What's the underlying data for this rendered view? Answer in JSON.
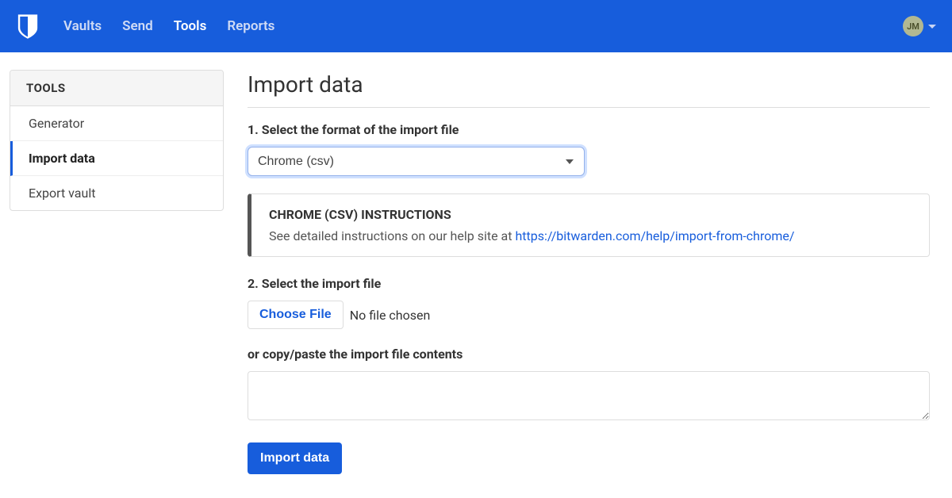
{
  "nav": {
    "items": [
      {
        "label": "Vaults",
        "active": false
      },
      {
        "label": "Send",
        "active": false
      },
      {
        "label": "Tools",
        "active": true
      },
      {
        "label": "Reports",
        "active": false
      }
    ]
  },
  "user": {
    "initials": "JM"
  },
  "sidebar": {
    "header": "TOOLS",
    "items": [
      {
        "label": "Generator",
        "active": false
      },
      {
        "label": "Import data",
        "active": true
      },
      {
        "label": "Export vault",
        "active": false
      }
    ]
  },
  "page": {
    "title": "Import data",
    "step1_label": "1. Select the format of the import file",
    "format_selected": "Chrome (csv)",
    "info": {
      "title": "CHROME (CSV) INSTRUCTIONS",
      "text_prefix": "See detailed instructions on our help site at ",
      "link_text": "https://bitwarden.com/help/import-from-chrome/"
    },
    "step2_label": "2. Select the import file",
    "choose_file_label": "Choose File",
    "no_file_text": "No file chosen",
    "or_text": "or copy/paste the import file contents",
    "import_button_label": "Import data"
  }
}
